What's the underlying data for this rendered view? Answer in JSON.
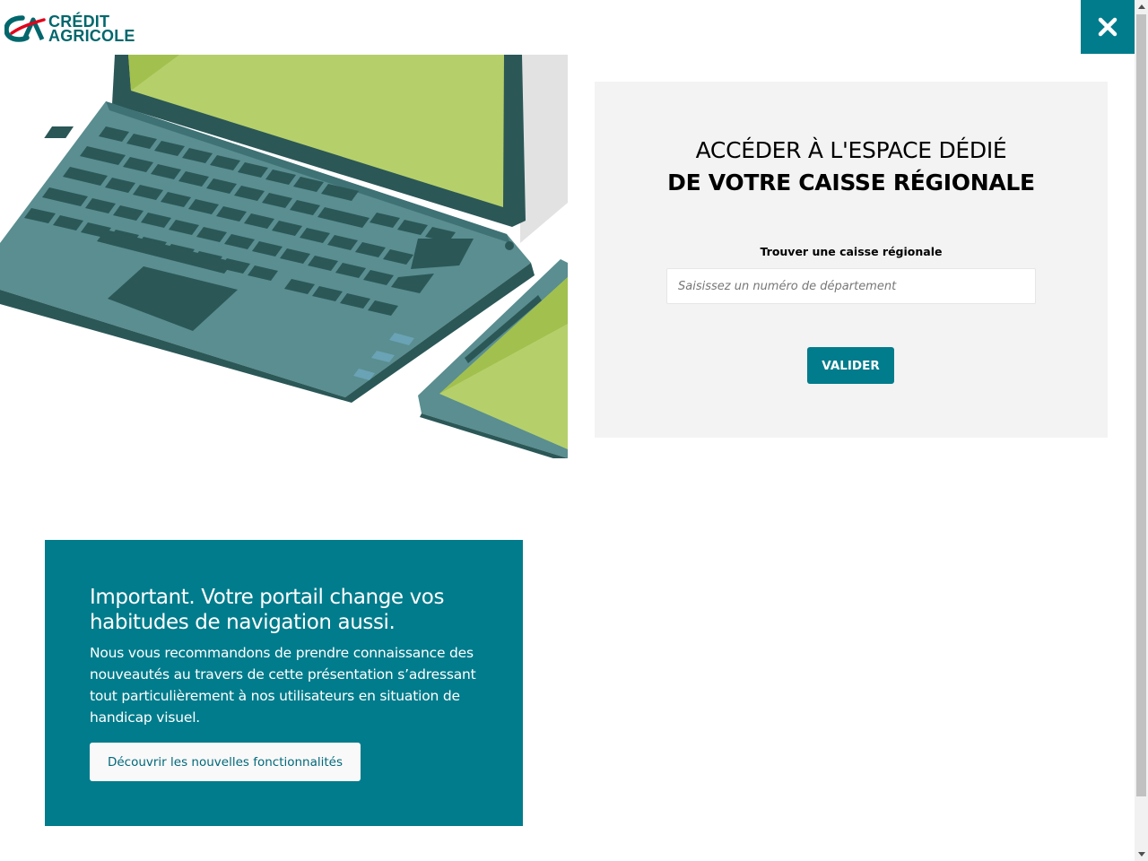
{
  "header": {
    "logo_line1": "CRÉDIT",
    "logo_line2": "AGRICOLE",
    "close_icon": "close-icon"
  },
  "hero": {
    "illustration": "laptop-and-tablet-illustration"
  },
  "panel": {
    "title_line1": "ACCÉDER À L'ESPACE DÉDIÉ",
    "title_line2": "DE VOTRE CAISSE RÉGIONALE",
    "field_label": "Trouver une caisse régionale",
    "search_placeholder": "Saisissez un numéro de département",
    "search_value": "",
    "validate_label": "VALIDER"
  },
  "info": {
    "title": "Important. Votre portail change vos habitudes de navigation aussi.",
    "text": "Nous vous recommandons de prendre connaissance des nouveautés au travers de cette présentation s’adressant tout particulièrement à nos utilisateurs en situation de handicap visuel.",
    "button_label": "Découvrir les nouvelles fonctionnalités"
  },
  "colors": {
    "accent": "#007c8c",
    "panel_bg": "#f3f3f3",
    "brand_green": "#00676c"
  }
}
